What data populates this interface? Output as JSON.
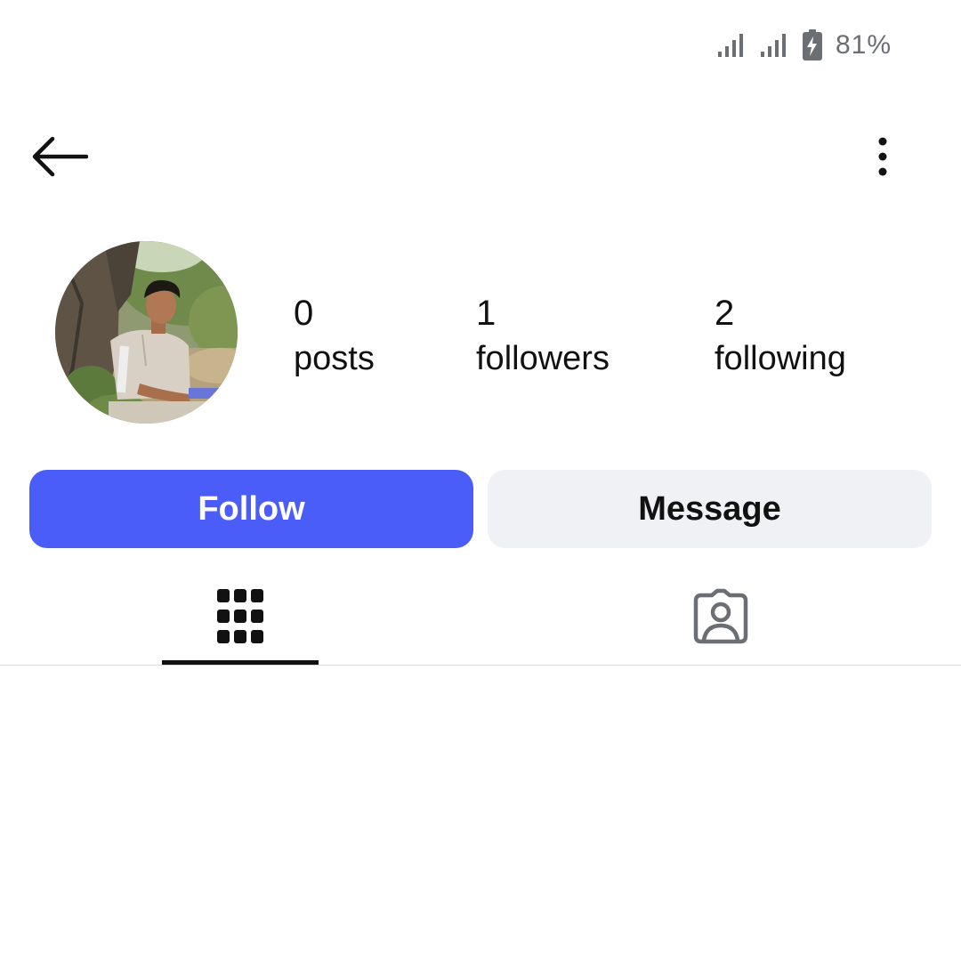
{
  "status_bar": {
    "battery_percent": "81%",
    "icons": [
      "signal-icon",
      "signal-icon",
      "battery-charging-icon"
    ]
  },
  "header": {
    "back_icon": "arrow-left-icon",
    "menu_icon": "more-vertical-icon"
  },
  "profile": {
    "avatar": "profile-photo",
    "stats": {
      "posts": {
        "count": "0",
        "label": "posts"
      },
      "followers": {
        "count": "1",
        "label": "followers"
      },
      "following": {
        "count": "2",
        "label": "following"
      }
    }
  },
  "actions": {
    "follow_label": "Follow",
    "message_label": "Message"
  },
  "tabs": [
    {
      "icon": "grid-icon",
      "active": true
    },
    {
      "icon": "tagged-user-icon",
      "active": false
    }
  ],
  "colors": {
    "accent": "#4a5df9",
    "secondary_button": "#f0f1f5",
    "status_gray": "#6b6e73",
    "text": "#111111"
  }
}
